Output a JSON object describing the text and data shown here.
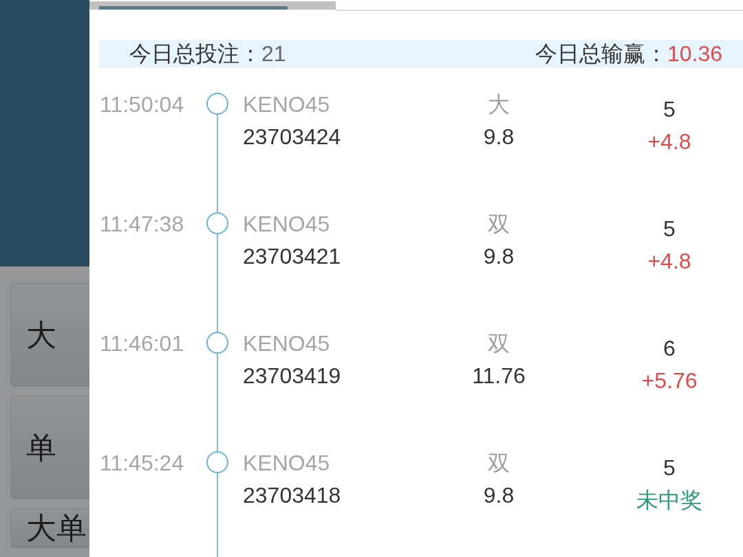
{
  "left_panel": {
    "buttons": [
      "大",
      "单",
      "大单"
    ]
  },
  "summary": {
    "bets_label": "今日总投注：",
    "bets_value": "21",
    "net_label": "今日总输赢：",
    "net_value": "10.36"
  },
  "records": [
    {
      "time": "11:50:04",
      "game": "KENO45",
      "issue": "23703424",
      "pick": "大",
      "payout": "9.8",
      "stake": "5",
      "result": {
        "text": "+4.8",
        "kind": "win"
      }
    },
    {
      "time": "11:47:38",
      "game": "KENO45",
      "issue": "23703421",
      "pick": "双",
      "payout": "9.8",
      "stake": "5",
      "result": {
        "text": "+4.8",
        "kind": "win"
      }
    },
    {
      "time": "11:46:01",
      "game": "KENO45",
      "issue": "23703419",
      "pick": "双",
      "payout": "11.76",
      "stake": "6",
      "result": {
        "text": "+5.76",
        "kind": "win"
      }
    },
    {
      "time": "11:45:24",
      "game": "KENO45",
      "issue": "23703418",
      "pick": "双",
      "payout": "9.8",
      "stake": "5",
      "result": {
        "text": "未中奖",
        "kind": "lose"
      }
    }
  ]
}
